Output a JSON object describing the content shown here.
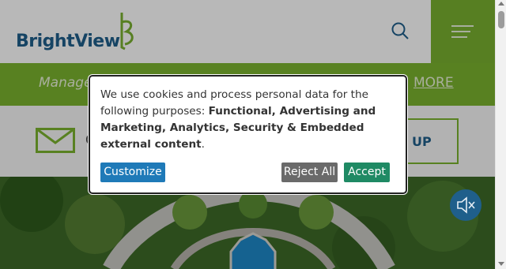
{
  "header": {
    "logo_text": "BrightView",
    "search_icon": "search-icon",
    "menu_icon": "hamburger-menu-icon",
    "menu_color": "#79b030"
  },
  "banner": {
    "text": "Manage",
    "link": "MORE",
    "color": "#7ab32e"
  },
  "newsletter": {
    "text": "C",
    "signup_label": "UP"
  },
  "cookie_dialog": {
    "intro": "We use cookies and process personal data for the following purposes: ",
    "purposes": "Functional, Advertising and Marketing, Analytics, Security & Embedded external content",
    "end": ".",
    "customize_label": "Customize",
    "reject_label": "Reject All",
    "accept_label": "Accept",
    "colors": {
      "customize": "#1f7ab8",
      "reject": "#6a6a6a",
      "accept": "#1f8a64"
    }
  },
  "media": {
    "sound_icon": "mute-speaker-icon"
  }
}
